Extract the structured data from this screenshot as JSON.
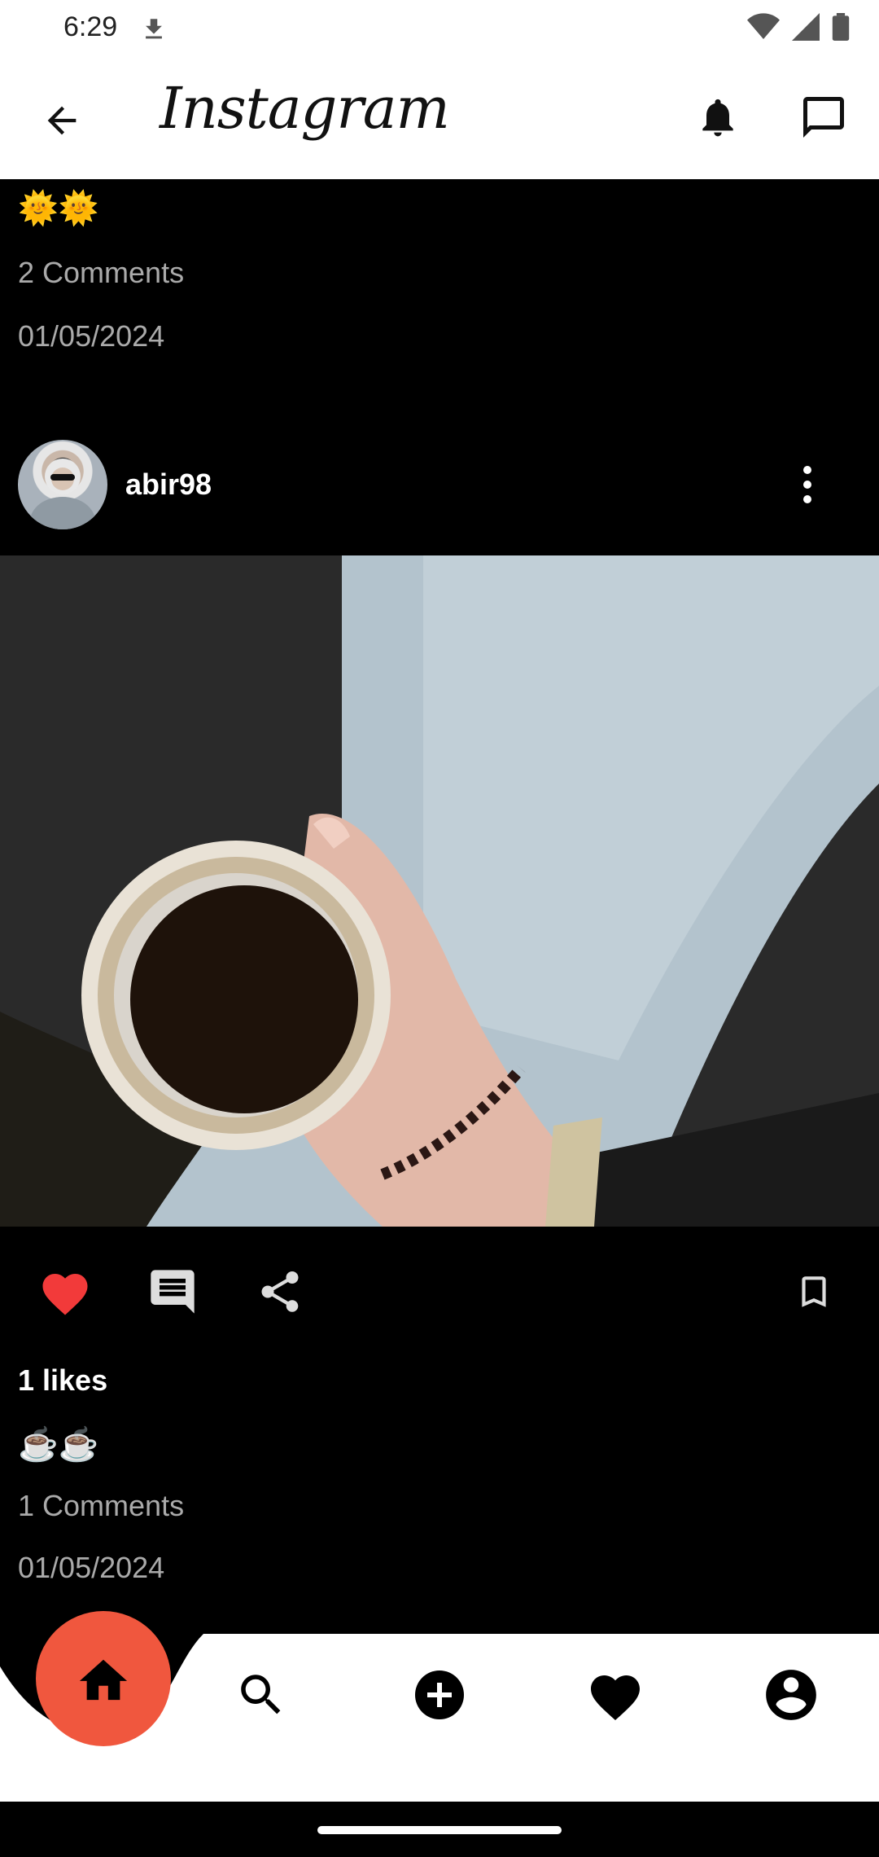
{
  "status_bar": {
    "time": "6:29"
  },
  "app_bar": {
    "title": "Instagram"
  },
  "previous_post": {
    "caption": "🌞🌞",
    "comments": "2 Comments",
    "date": "01/05/2024"
  },
  "post": {
    "username": "abir98",
    "likes": "1 likes",
    "caption": "☕☕",
    "comments": "1 Comments",
    "date": "01/05/2024",
    "liked": true
  },
  "colors": {
    "accent": "#f0573e",
    "like": "#f23a3a",
    "background": "#000000",
    "bar": "#ffffff"
  },
  "bottom_nav": [
    "home-icon",
    "search-icon",
    "add-icon",
    "heart-icon",
    "account-icon"
  ]
}
